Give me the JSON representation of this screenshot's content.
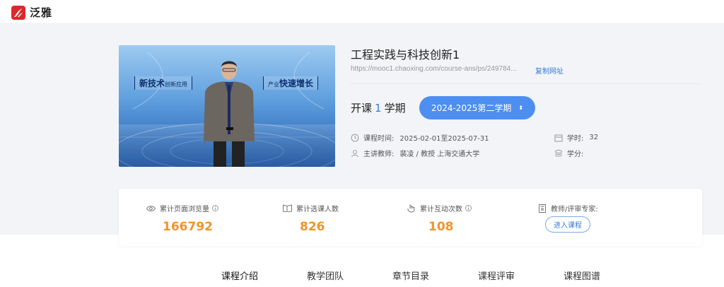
{
  "header": {
    "brand": "泛雅",
    "brand_color": "#e0262b"
  },
  "course": {
    "title": "工程实践与科技创新1",
    "url": "https://mooc1.chaoxing.com/course-ans/ps/249784...",
    "copy_label": "复制网址",
    "thumbnail": {
      "tag_left_main": "新技术",
      "tag_left_small": "创新应用",
      "tag_right_small": "产业",
      "tag_right_main": "快速增长"
    },
    "semester": {
      "prefix": "开课",
      "count": "1",
      "suffix": "学期"
    },
    "term_select": {
      "value": "2024-2025第二学期",
      "icon": "chevron-updown-icon"
    },
    "time_label": "课程时间:",
    "time_value": "2025-02-01至2025-07-31",
    "teacher_label": "主讲教师:",
    "teacher_value": "裴凌 / 教授 上海交通大学",
    "hours_label": "学时:",
    "hours_value": "32",
    "credits_label": "学分:",
    "credits_value": ""
  },
  "stats": {
    "views_label": "累计页面浏览量",
    "views_value": "166792",
    "enrolled_label": "累计选课人数",
    "enrolled_value": "826",
    "interactions_label": "累计互动次数",
    "interactions_value": "108",
    "experts_label": "教师/评审专家:",
    "enter_label": "进入课程",
    "value_color": "#f2932c"
  },
  "tabs": [
    "课程介绍",
    "教学团队",
    "章节目录",
    "课程评审",
    "课程图谱"
  ],
  "colors": {
    "accent": "#4d8ff0",
    "link": "#3a7bd5"
  }
}
